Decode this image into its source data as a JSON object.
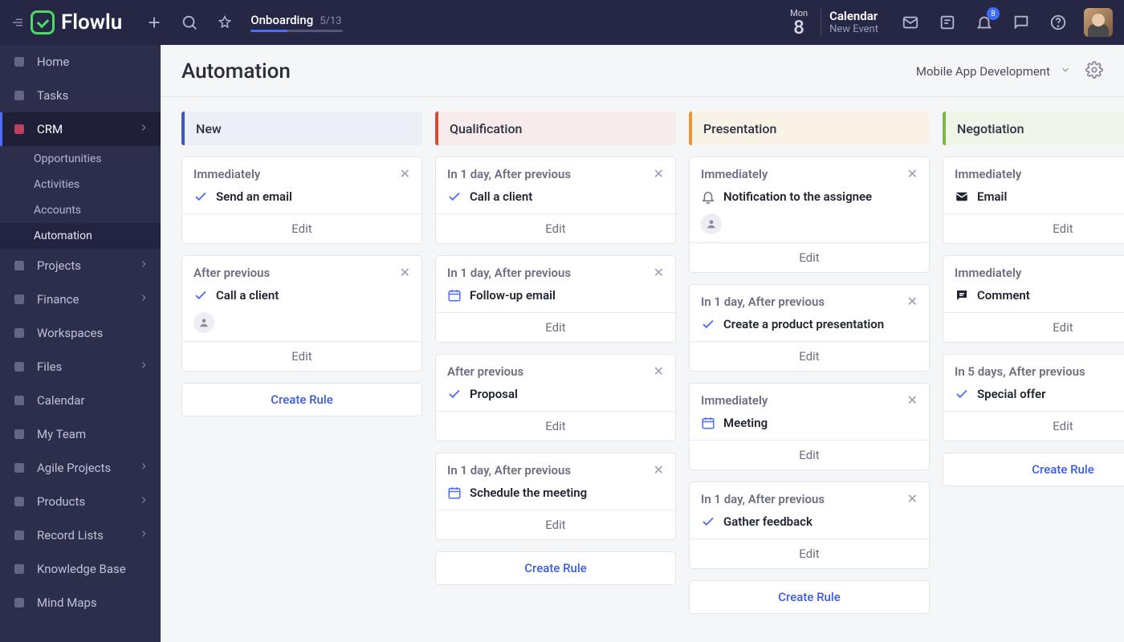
{
  "brand": "Flowlu",
  "topbar": {
    "onboarding_label": "Onboarding",
    "onboarding_count": "5/13",
    "date_dow": "Mon",
    "date_dom": "8",
    "calendar_label": "Calendar",
    "new_event_label": "New Event",
    "notif_badge": "8"
  },
  "sidebar": {
    "items": [
      {
        "id": "home",
        "label": "Home",
        "expandable": false
      },
      {
        "id": "tasks",
        "label": "Tasks",
        "expandable": false
      },
      {
        "id": "crm",
        "label": "CRM",
        "expandable": true,
        "active": true,
        "children": [
          {
            "id": "opportunities",
            "label": "Opportunities"
          },
          {
            "id": "activities",
            "label": "Activities"
          },
          {
            "id": "accounts",
            "label": "Accounts"
          },
          {
            "id": "automation",
            "label": "Automation",
            "current": true
          }
        ]
      },
      {
        "id": "projects",
        "label": "Projects",
        "expandable": true
      },
      {
        "id": "finance",
        "label": "Finance",
        "expandable": true
      },
      {
        "id": "workspaces",
        "label": "Workspaces",
        "expandable": false
      },
      {
        "id": "files",
        "label": "Files",
        "expandable": true
      },
      {
        "id": "calendar",
        "label": "Calendar",
        "expandable": false
      },
      {
        "id": "myteam",
        "label": "My Team",
        "expandable": false
      },
      {
        "id": "agile",
        "label": "Agile Projects",
        "expandable": true
      },
      {
        "id": "products",
        "label": "Products",
        "expandable": true
      },
      {
        "id": "records",
        "label": "Record Lists",
        "expandable": true
      },
      {
        "id": "kb",
        "label": "Knowledge Base",
        "expandable": false
      },
      {
        "id": "mindmaps",
        "label": "Mind Maps",
        "expandable": false
      }
    ]
  },
  "page": {
    "title": "Automation",
    "project_selector": "Mobile App Development"
  },
  "labels": {
    "edit": "Edit",
    "create_rule": "Create Rule"
  },
  "columns": [
    {
      "title": "New",
      "color_class": "c0",
      "cards": [
        {
          "timing": "Immediately",
          "icon": "check",
          "action": "Send an email"
        },
        {
          "timing": "After previous",
          "icon": "check",
          "action": "Call a client",
          "assignee": true
        }
      ]
    },
    {
      "title": "Qualification",
      "color_class": "c1",
      "cards": [
        {
          "timing": "In 1 day, After previous",
          "icon": "check",
          "action": "Call a client"
        },
        {
          "timing": "In 1 day, After previous",
          "icon": "cal",
          "action": "Follow-up email"
        },
        {
          "timing": "After previous",
          "icon": "check",
          "action": "Proposal"
        },
        {
          "timing": "In 1 day, After previous",
          "icon": "cal",
          "action": "Schedule the meeting"
        }
      ]
    },
    {
      "title": "Presentation",
      "color_class": "c2",
      "cards": [
        {
          "timing": "Immediately",
          "icon": "bell",
          "action": "Notification to the assignee",
          "assignee": true
        },
        {
          "timing": "In 1 day, After previous",
          "icon": "check",
          "action": "Create a product presentation"
        },
        {
          "timing": "Immediately",
          "icon": "cal",
          "action": "Meeting"
        },
        {
          "timing": "In 1 day, After previous",
          "icon": "check",
          "action": "Gather feedback"
        }
      ]
    },
    {
      "title": "Negotiation",
      "color_class": "c3",
      "cards": [
        {
          "timing": "Immediately",
          "icon": "mail",
          "action": "Email"
        },
        {
          "timing": "Immediately",
          "icon": "comment",
          "action": "Comment"
        },
        {
          "timing": "In 5 days, After previous",
          "icon": "check",
          "action": "Special offer"
        }
      ]
    }
  ]
}
